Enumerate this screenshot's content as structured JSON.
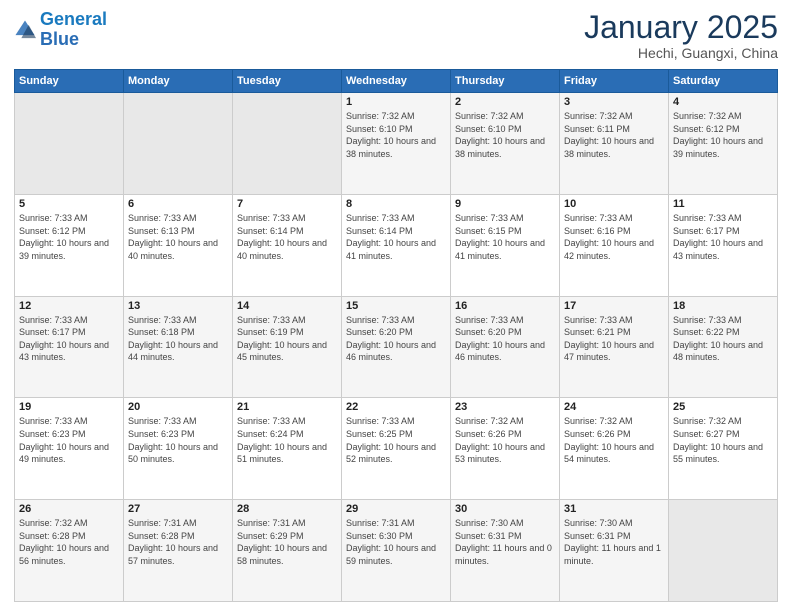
{
  "header": {
    "logo_line1": "General",
    "logo_line2": "Blue",
    "title": "January 2025",
    "subtitle": "Hechi, Guangxi, China"
  },
  "weekdays": [
    "Sunday",
    "Monday",
    "Tuesday",
    "Wednesday",
    "Thursday",
    "Friday",
    "Saturday"
  ],
  "weeks": [
    [
      {
        "day": "",
        "sunrise": "",
        "sunset": "",
        "daylight": ""
      },
      {
        "day": "",
        "sunrise": "",
        "sunset": "",
        "daylight": ""
      },
      {
        "day": "",
        "sunrise": "",
        "sunset": "",
        "daylight": ""
      },
      {
        "day": "1",
        "sunrise": "Sunrise: 7:32 AM",
        "sunset": "Sunset: 6:10 PM",
        "daylight": "Daylight: 10 hours and 38 minutes."
      },
      {
        "day": "2",
        "sunrise": "Sunrise: 7:32 AM",
        "sunset": "Sunset: 6:10 PM",
        "daylight": "Daylight: 10 hours and 38 minutes."
      },
      {
        "day": "3",
        "sunrise": "Sunrise: 7:32 AM",
        "sunset": "Sunset: 6:11 PM",
        "daylight": "Daylight: 10 hours and 38 minutes."
      },
      {
        "day": "4",
        "sunrise": "Sunrise: 7:32 AM",
        "sunset": "Sunset: 6:12 PM",
        "daylight": "Daylight: 10 hours and 39 minutes."
      }
    ],
    [
      {
        "day": "5",
        "sunrise": "Sunrise: 7:33 AM",
        "sunset": "Sunset: 6:12 PM",
        "daylight": "Daylight: 10 hours and 39 minutes."
      },
      {
        "day": "6",
        "sunrise": "Sunrise: 7:33 AM",
        "sunset": "Sunset: 6:13 PM",
        "daylight": "Daylight: 10 hours and 40 minutes."
      },
      {
        "day": "7",
        "sunrise": "Sunrise: 7:33 AM",
        "sunset": "Sunset: 6:14 PM",
        "daylight": "Daylight: 10 hours and 40 minutes."
      },
      {
        "day": "8",
        "sunrise": "Sunrise: 7:33 AM",
        "sunset": "Sunset: 6:14 PM",
        "daylight": "Daylight: 10 hours and 41 minutes."
      },
      {
        "day": "9",
        "sunrise": "Sunrise: 7:33 AM",
        "sunset": "Sunset: 6:15 PM",
        "daylight": "Daylight: 10 hours and 41 minutes."
      },
      {
        "day": "10",
        "sunrise": "Sunrise: 7:33 AM",
        "sunset": "Sunset: 6:16 PM",
        "daylight": "Daylight: 10 hours and 42 minutes."
      },
      {
        "day": "11",
        "sunrise": "Sunrise: 7:33 AM",
        "sunset": "Sunset: 6:17 PM",
        "daylight": "Daylight: 10 hours and 43 minutes."
      }
    ],
    [
      {
        "day": "12",
        "sunrise": "Sunrise: 7:33 AM",
        "sunset": "Sunset: 6:17 PM",
        "daylight": "Daylight: 10 hours and 43 minutes."
      },
      {
        "day": "13",
        "sunrise": "Sunrise: 7:33 AM",
        "sunset": "Sunset: 6:18 PM",
        "daylight": "Daylight: 10 hours and 44 minutes."
      },
      {
        "day": "14",
        "sunrise": "Sunrise: 7:33 AM",
        "sunset": "Sunset: 6:19 PM",
        "daylight": "Daylight: 10 hours and 45 minutes."
      },
      {
        "day": "15",
        "sunrise": "Sunrise: 7:33 AM",
        "sunset": "Sunset: 6:20 PM",
        "daylight": "Daylight: 10 hours and 46 minutes."
      },
      {
        "day": "16",
        "sunrise": "Sunrise: 7:33 AM",
        "sunset": "Sunset: 6:20 PM",
        "daylight": "Daylight: 10 hours and 46 minutes."
      },
      {
        "day": "17",
        "sunrise": "Sunrise: 7:33 AM",
        "sunset": "Sunset: 6:21 PM",
        "daylight": "Daylight: 10 hours and 47 minutes."
      },
      {
        "day": "18",
        "sunrise": "Sunrise: 7:33 AM",
        "sunset": "Sunset: 6:22 PM",
        "daylight": "Daylight: 10 hours and 48 minutes."
      }
    ],
    [
      {
        "day": "19",
        "sunrise": "Sunrise: 7:33 AM",
        "sunset": "Sunset: 6:23 PM",
        "daylight": "Daylight: 10 hours and 49 minutes."
      },
      {
        "day": "20",
        "sunrise": "Sunrise: 7:33 AM",
        "sunset": "Sunset: 6:23 PM",
        "daylight": "Daylight: 10 hours and 50 minutes."
      },
      {
        "day": "21",
        "sunrise": "Sunrise: 7:33 AM",
        "sunset": "Sunset: 6:24 PM",
        "daylight": "Daylight: 10 hours and 51 minutes."
      },
      {
        "day": "22",
        "sunrise": "Sunrise: 7:33 AM",
        "sunset": "Sunset: 6:25 PM",
        "daylight": "Daylight: 10 hours and 52 minutes."
      },
      {
        "day": "23",
        "sunrise": "Sunrise: 7:32 AM",
        "sunset": "Sunset: 6:26 PM",
        "daylight": "Daylight: 10 hours and 53 minutes."
      },
      {
        "day": "24",
        "sunrise": "Sunrise: 7:32 AM",
        "sunset": "Sunset: 6:26 PM",
        "daylight": "Daylight: 10 hours and 54 minutes."
      },
      {
        "day": "25",
        "sunrise": "Sunrise: 7:32 AM",
        "sunset": "Sunset: 6:27 PM",
        "daylight": "Daylight: 10 hours and 55 minutes."
      }
    ],
    [
      {
        "day": "26",
        "sunrise": "Sunrise: 7:32 AM",
        "sunset": "Sunset: 6:28 PM",
        "daylight": "Daylight: 10 hours and 56 minutes."
      },
      {
        "day": "27",
        "sunrise": "Sunrise: 7:31 AM",
        "sunset": "Sunset: 6:28 PM",
        "daylight": "Daylight: 10 hours and 57 minutes."
      },
      {
        "day": "28",
        "sunrise": "Sunrise: 7:31 AM",
        "sunset": "Sunset: 6:29 PM",
        "daylight": "Daylight: 10 hours and 58 minutes."
      },
      {
        "day": "29",
        "sunrise": "Sunrise: 7:31 AM",
        "sunset": "Sunset: 6:30 PM",
        "daylight": "Daylight: 10 hours and 59 minutes."
      },
      {
        "day": "30",
        "sunrise": "Sunrise: 7:30 AM",
        "sunset": "Sunset: 6:31 PM",
        "daylight": "Daylight: 11 hours and 0 minutes."
      },
      {
        "day": "31",
        "sunrise": "Sunrise: 7:30 AM",
        "sunset": "Sunset: 6:31 PM",
        "daylight": "Daylight: 11 hours and 1 minute."
      },
      {
        "day": "",
        "sunrise": "",
        "sunset": "",
        "daylight": ""
      }
    ]
  ]
}
